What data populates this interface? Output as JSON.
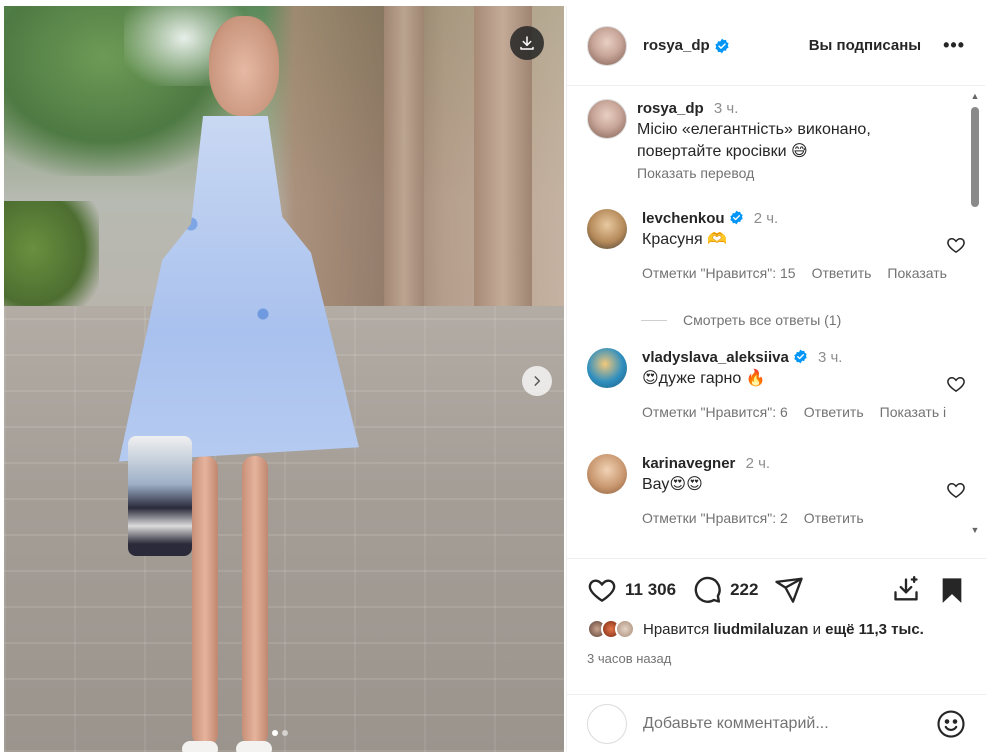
{
  "post": {
    "username": "rosya_dp",
    "follow_state": "Вы подписаны",
    "more": "•••",
    "caption": {
      "username": "rosya_dp",
      "time": "3 ч.",
      "text_line1": "Місію «елегантність» виконано,",
      "text_line2": "повертайте кросівки 😅",
      "translate": "Показать перевод"
    },
    "carousel": {
      "total": 2,
      "active": 1
    }
  },
  "comments": [
    {
      "username": "levchenkou",
      "verified": true,
      "time": "2 ч.",
      "text": "Красуня 🫶",
      "likes": "Отметки \"Нравится\": 15",
      "reply": "Ответить",
      "show": "Показать",
      "view_replies": "Смотреть все ответы (1)"
    },
    {
      "username": "vladyslava_aleksiiva",
      "verified": true,
      "time": "3 ч.",
      "text": "😍дуже гарно 🔥",
      "likes": "Отметки \"Нравится\": 6",
      "reply": "Ответить",
      "show": "Показать і"
    },
    {
      "username": "karinavegner",
      "verified": false,
      "time": "2 ч.",
      "text": "Вау😍😍",
      "likes": "Отметки \"Нравится\": 2",
      "reply": "Ответить"
    }
  ],
  "actions": {
    "like_count": "11 306",
    "comment_count": "222"
  },
  "likes_summary": {
    "prefix": "Нравится",
    "user": "liudmilaluzan",
    "middle": "и",
    "rest": "ещё 11,3 тыс."
  },
  "posted_ago": "3 часов назад",
  "comment_input": {
    "placeholder": "Добавьте комментарий..."
  },
  "colors": {
    "verified": "#0095f6",
    "text": "#262626",
    "muted": "#737373",
    "divider": "#efefef"
  },
  "icons": [
    "download-icon",
    "chevron-right-icon",
    "more-icon",
    "verified-icon",
    "heart-icon",
    "comment-icon",
    "share-icon",
    "save-icon",
    "emoji-icon"
  ]
}
